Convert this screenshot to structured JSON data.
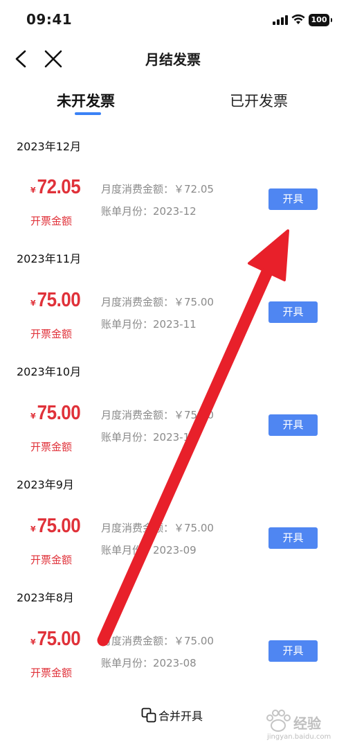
{
  "status": {
    "time": "09:41",
    "battery": "100"
  },
  "nav": {
    "title": "月结发票"
  },
  "tabs": {
    "active": "未开发票",
    "inactive": "已开发票"
  },
  "records": [
    {
      "month": "2023年12月",
      "yen": "¥",
      "amount": "72.05",
      "amount_label": "开票金额",
      "consume": "月度消费金额：￥72.05",
      "bill_month": "账单月份：2023-12",
      "button": "开具"
    },
    {
      "month": "2023年11月",
      "yen": "¥",
      "amount": "75.00",
      "amount_label": "开票金额",
      "consume": "月度消费金额：￥75.00",
      "bill_month": "账单月份：2023-11",
      "button": "开具"
    },
    {
      "month": "2023年10月",
      "yen": "¥",
      "amount": "75.00",
      "amount_label": "开票金额",
      "consume": "月度消费金额：￥75.00",
      "bill_month": "账单月份：2023-10",
      "button": "开具"
    },
    {
      "month": "2023年9月",
      "yen": "¥",
      "amount": "75.00",
      "amount_label": "开票金额",
      "consume": "月度消费金额：￥75.00",
      "bill_month": "账单月份：2023-09",
      "button": "开具"
    },
    {
      "month": "2023年8月",
      "yen": "¥",
      "amount": "75.00",
      "amount_label": "开票金额",
      "consume": "月度消费金额：￥75.00",
      "bill_month": "账单月份：2023-08",
      "button": "开具"
    }
  ],
  "footer": {
    "merge_label": "合并开具"
  },
  "watermark": {
    "text": "经验",
    "url": "jingyan.baidu.com"
  },
  "colors": {
    "accent": "#4f86f2",
    "amount": "#e0323a",
    "arrow": "#e8202a",
    "tab_underline": "#3b82f6"
  }
}
